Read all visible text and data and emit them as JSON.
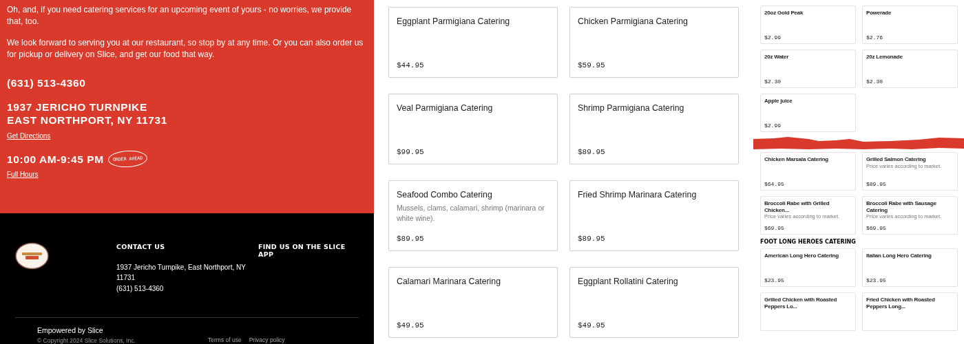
{
  "intro": {
    "paragraphs": [
      "Oh, and, if you need catering services for an upcoming event of yours - no worries, we provide that, too.",
      "We look forward to serving you at our restaurant, so stop by at any time. Or you can also order us for pickup or delivery on Slice, and get our food that way."
    ]
  },
  "phone": "(631) 513-4360",
  "address_lines": [
    "1937 JERICHO TURNPIKE",
    "EAST NORTHPORT, NY 11731"
  ],
  "directions_link": "Get Directions",
  "hours": "10:00 AM-9:45 PM",
  "order_ahead_badge": "ORDER AHEAD",
  "hours_link": "Full Hours",
  "footer": {
    "contact_heading": "CONTACT US",
    "contact_address": "1937 Jericho Turnpike, East Northport, NY 11731",
    "contact_phone": "(631) 513-4360",
    "app_heading": "FIND US ON THE SLICE APP",
    "powered_by": "Empowered by Slice",
    "copyright": "© Copyright 2024 Slice Solutions, Inc.",
    "links": [
      "Terms of use",
      "Privacy policy"
    ]
  },
  "catering_items": [
    {
      "name": "Eggplant Parmigiana Catering",
      "price": "$44.95"
    },
    {
      "name": "Chicken Parmigiana Catering",
      "price": "$59.95"
    },
    {
      "name": "Veal Parmigiana Catering",
      "price": "$99.95"
    },
    {
      "name": "Shrimp Parmigiana Catering",
      "price": "$89.95"
    },
    {
      "name": "Seafood Combo Catering",
      "description": "Mussels, clams, calamari, shrimp (marinara or white wine).",
      "price": "$89.95"
    },
    {
      "name": "Fried Shrimp Marinara Catering",
      "price": "$89.95"
    },
    {
      "name": "Calamari Marinara Catering",
      "price": "$49.95"
    },
    {
      "name": "Eggplant Rollatini Catering",
      "price": "$49.95"
    }
  ],
  "menu_panel": {
    "drinks": [
      {
        "name": "20oz Gold Peak",
        "price": "$2.99"
      },
      {
        "name": "Powerade",
        "price": "$2.76"
      },
      {
        "name": "20z Water",
        "price": "$2.30"
      },
      {
        "name": "20z Lemonade",
        "price": "$2.30"
      },
      {
        "name": "Apple juice",
        "price": "$2.99"
      }
    ],
    "catering_items": [
      {
        "name": "Chicken Marsala Catering",
        "price": "$64.95"
      },
      {
        "name": "Grilled Salmon Catering",
        "description": "Price varies according to market.",
        "price": "$89.95"
      },
      {
        "name": "Broccoli Rabe with Grilled Chicken...",
        "description": "Price varies according to market.",
        "price": "$69.95"
      },
      {
        "name": "Broccoli Rabe with Sausage Catering",
        "description": "Price varies according to market.",
        "price": "$69.95"
      }
    ],
    "section_heading": "FOOT LONG HEROES CATERING",
    "heroes": [
      {
        "name": "American Long Hero Catering",
        "price": "$23.95"
      },
      {
        "name": "Italian Long Hero Catering",
        "price": "$23.95"
      },
      {
        "name": "Grilled Chicken with Roasted Peppers Lo..."
      },
      {
        "name": "Fried Chicken with Roasted Peppers Long..."
      }
    ]
  }
}
